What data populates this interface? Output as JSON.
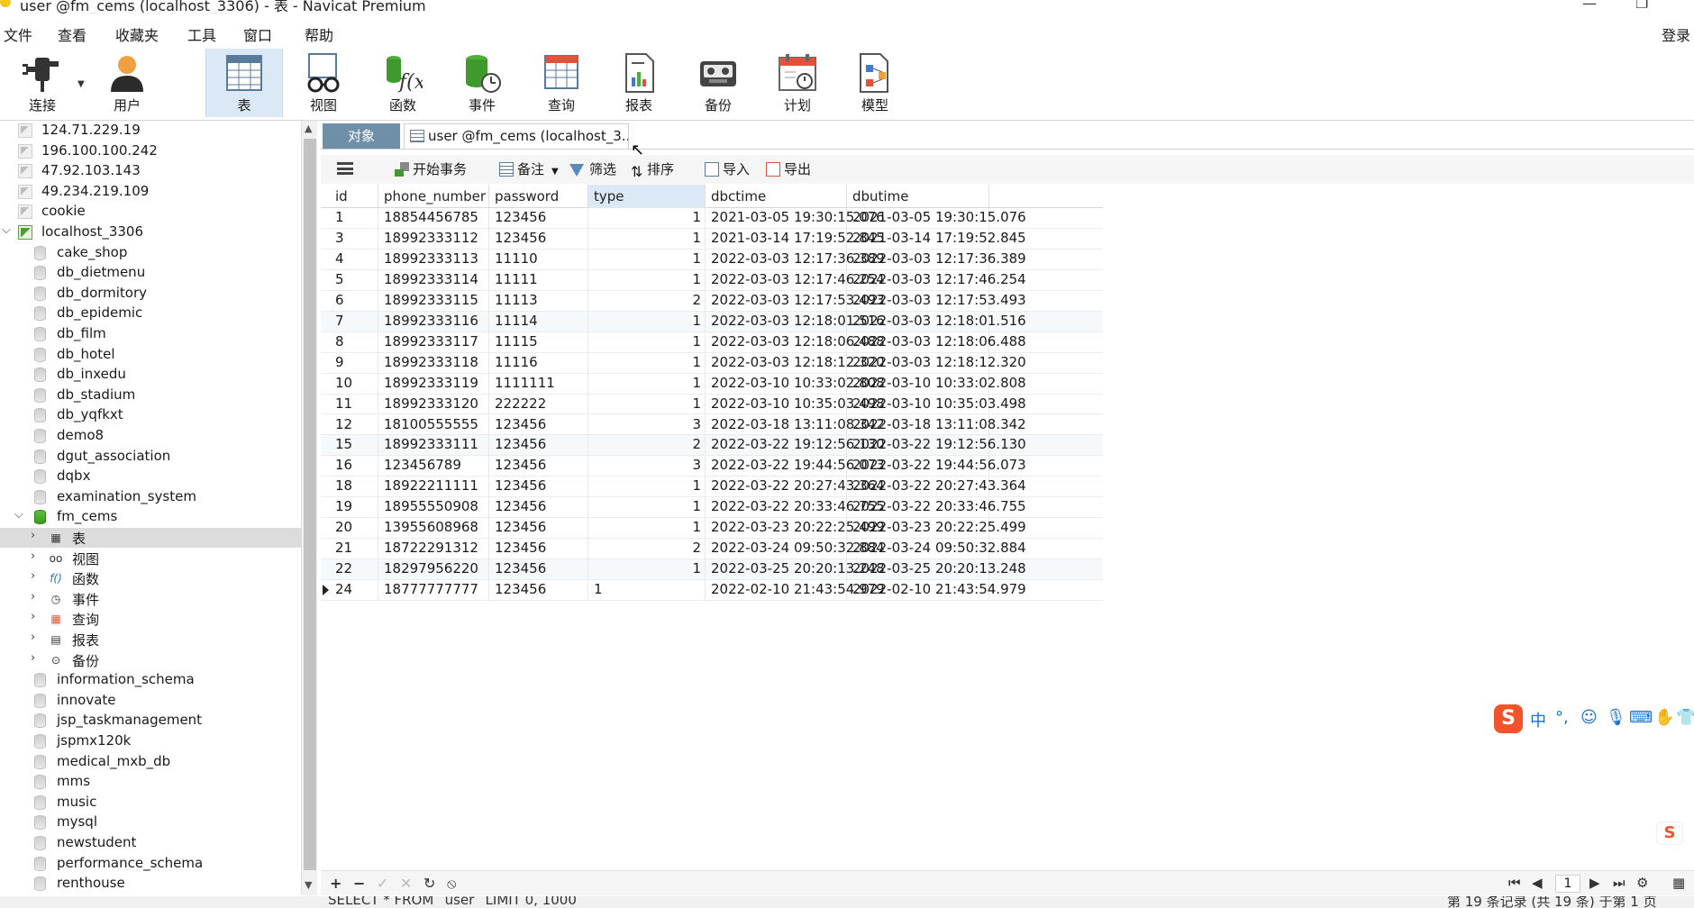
{
  "window": {
    "title": "user @fm_cems (localhost_3306) - 表 - Navicat Premium",
    "minimize": "—",
    "restore": "❐"
  },
  "menu": {
    "items": [
      "文件",
      "查看",
      "收藏夹",
      "工具",
      "窗口",
      "帮助"
    ],
    "login": "登录"
  },
  "toolbar": {
    "buttons": [
      {
        "label": "连接",
        "icon": "plug-icon"
      },
      {
        "label": "用户",
        "icon": "user-icon"
      },
      {
        "label": "表",
        "icon": "table-icon",
        "active": true
      },
      {
        "label": "视图",
        "icon": "view-icon"
      },
      {
        "label": "函数",
        "icon": "function-icon"
      },
      {
        "label": "事件",
        "icon": "event-icon"
      },
      {
        "label": "查询",
        "icon": "query-icon"
      },
      {
        "label": "报表",
        "icon": "report-icon"
      },
      {
        "label": "备份",
        "icon": "backup-icon"
      },
      {
        "label": "计划",
        "icon": "schedule-icon"
      },
      {
        "label": "模型",
        "icon": "model-icon"
      }
    ]
  },
  "navigator": {
    "items": [
      {
        "label": "124.71.229.19",
        "kind": "connection"
      },
      {
        "label": "196.100.100.242",
        "kind": "connection"
      },
      {
        "label": "47.92.103.143",
        "kind": "connection"
      },
      {
        "label": "49.234.219.109",
        "kind": "connection"
      },
      {
        "label": "cookie",
        "kind": "connection"
      },
      {
        "label": "localhost_3306",
        "kind": "connection-open"
      },
      {
        "label": "cake_shop",
        "kind": "db"
      },
      {
        "label": "db_dietmenu",
        "kind": "db"
      },
      {
        "label": "db_dormitory",
        "kind": "db"
      },
      {
        "label": "db_epidemic",
        "kind": "db"
      },
      {
        "label": "db_film",
        "kind": "db"
      },
      {
        "label": "db_hotel",
        "kind": "db"
      },
      {
        "label": "db_inxedu",
        "kind": "db"
      },
      {
        "label": "db_stadium",
        "kind": "db"
      },
      {
        "label": "db_yqfkxt",
        "kind": "db"
      },
      {
        "label": "demo8",
        "kind": "db"
      },
      {
        "label": "dgut_association",
        "kind": "db"
      },
      {
        "label": "dqbx",
        "kind": "db"
      },
      {
        "label": "examination_system",
        "kind": "db"
      },
      {
        "label": "fm_cems",
        "kind": "db-open"
      },
      {
        "label": "表",
        "kind": "child",
        "icon": "table-icon",
        "selected": true
      },
      {
        "label": "视图",
        "kind": "child",
        "icon": "view-icon"
      },
      {
        "label": "函数",
        "kind": "child",
        "icon": "function-icon"
      },
      {
        "label": "事件",
        "kind": "child",
        "icon": "event-icon"
      },
      {
        "label": "查询",
        "kind": "child",
        "icon": "query-icon"
      },
      {
        "label": "报表",
        "kind": "child",
        "icon": "report-icon"
      },
      {
        "label": "备份",
        "kind": "child",
        "icon": "backup-icon"
      },
      {
        "label": "information_schema",
        "kind": "db"
      },
      {
        "label": "innovate",
        "kind": "db"
      },
      {
        "label": "jsp_taskmanagement",
        "kind": "db"
      },
      {
        "label": "jspmx120k",
        "kind": "db"
      },
      {
        "label": "medical_mxb_db",
        "kind": "db"
      },
      {
        "label": "mms",
        "kind": "db"
      },
      {
        "label": "music",
        "kind": "db"
      },
      {
        "label": "mysql",
        "kind": "db"
      },
      {
        "label": "newstudent",
        "kind": "db"
      },
      {
        "label": "performance_schema",
        "kind": "db"
      },
      {
        "label": "renthouse",
        "kind": "db"
      }
    ]
  },
  "tabs": {
    "objects": "对象",
    "user_tab": "user @fm_cems (localhost_3..."
  },
  "table_toolbar": {
    "begin_transaction": "开始事务",
    "memo": "备注",
    "filter": "筛选",
    "sort": "排序",
    "import": "导入",
    "export": "导出"
  },
  "grid": {
    "columns": [
      "id",
      "phone_number",
      "password",
      "type",
      "dbctime",
      "dbutime"
    ],
    "rows": [
      [
        "1",
        "18854456785",
        "123456",
        "1",
        "2021-03-05 19:30:15.076",
        "2021-03-05 19:30:15.076"
      ],
      [
        "3",
        "18992333112",
        "123456",
        "1",
        "2021-03-14 17:19:52.845",
        "2021-03-14 17:19:52.845"
      ],
      [
        "4",
        "18992333113",
        "11110",
        "1",
        "2022-03-03 12:17:36.389",
        "2022-03-03 12:17:36.389"
      ],
      [
        "5",
        "18992333114",
        "11111",
        "1",
        "2022-03-03 12:17:46.254",
        "2022-03-03 12:17:46.254"
      ],
      [
        "6",
        "18992333115",
        "11113",
        "2",
        "2022-03-03 12:17:53.493",
        "2022-03-03 12:17:53.493"
      ],
      [
        "7",
        "18992333116",
        "11114",
        "1",
        "2022-03-03 12:18:01.516",
        "2022-03-03 12:18:01.516"
      ],
      [
        "8",
        "18992333117",
        "11115",
        "1",
        "2022-03-03 12:18:06.488",
        "2022-03-03 12:18:06.488"
      ],
      [
        "9",
        "18992333118",
        "11116",
        "1",
        "2022-03-03 12:18:12.320",
        "2022-03-03 12:18:12.320"
      ],
      [
        "10",
        "18992333119",
        "1111111",
        "1",
        "2022-03-10 10:33:02.808",
        "2022-03-10 10:33:02.808"
      ],
      [
        "11",
        "18992333120",
        "222222",
        "1",
        "2022-03-10 10:35:03.498",
        "2022-03-10 10:35:03.498"
      ],
      [
        "12",
        "18100555555",
        "123456",
        "3",
        "2022-03-18 13:11:08.342",
        "2022-03-18 13:11:08.342"
      ],
      [
        "15",
        "18992333111",
        "123456",
        "2",
        "2022-03-22 19:12:56.130",
        "2022-03-22 19:12:56.130"
      ],
      [
        "16",
        "123456789",
        "123456",
        "3",
        "2022-03-22 19:44:56.073",
        "2022-03-22 19:44:56.073"
      ],
      [
        "18",
        "18922211111",
        "123456",
        "1",
        "2022-03-22 20:27:43.364",
        "2022-03-22 20:27:43.364"
      ],
      [
        "19",
        "18955550908",
        "123456",
        "1",
        "2022-03-22 20:33:46.755",
        "2022-03-22 20:33:46.755"
      ],
      [
        "20",
        "13955608968",
        "123456",
        "1",
        "2022-03-23 20:22:25.499",
        "2022-03-23 20:22:25.499"
      ],
      [
        "21",
        "18722291312",
        "123456",
        "2",
        "2022-03-24 09:50:32.884",
        "2022-03-24 09:50:32.884"
      ],
      [
        "22",
        "18297956220",
        "123456",
        "1",
        "2022-03-25 20:20:13.248",
        "2022-03-25 20:20:13.248"
      ],
      [
        "24",
        "18777777777",
        "123456",
        "1",
        "2022-02-10 21:43:54.979",
        "2022-02-10 21:43:54.979"
      ]
    ],
    "current_row_index": 18
  },
  "bottom_bar": {
    "add": "+",
    "delete": "−",
    "apply": "✓",
    "discard": "✕",
    "refresh": "↻",
    "stop": "⦸",
    "page": "1"
  },
  "status": {
    "sql": "SELECT * FROM `user` LIMIT 0, 1000",
    "count": "第 19 条记录 (共 19 条) 于第 1 页"
  },
  "ime": {
    "logo": "S",
    "lang": "中",
    "punct": "°,",
    "logo2": "S"
  },
  "colors": {
    "selected_header": "#dbe9f7",
    "objects_tab": "#6f8fa8",
    "active_toolbar": "#dbe9f7"
  }
}
